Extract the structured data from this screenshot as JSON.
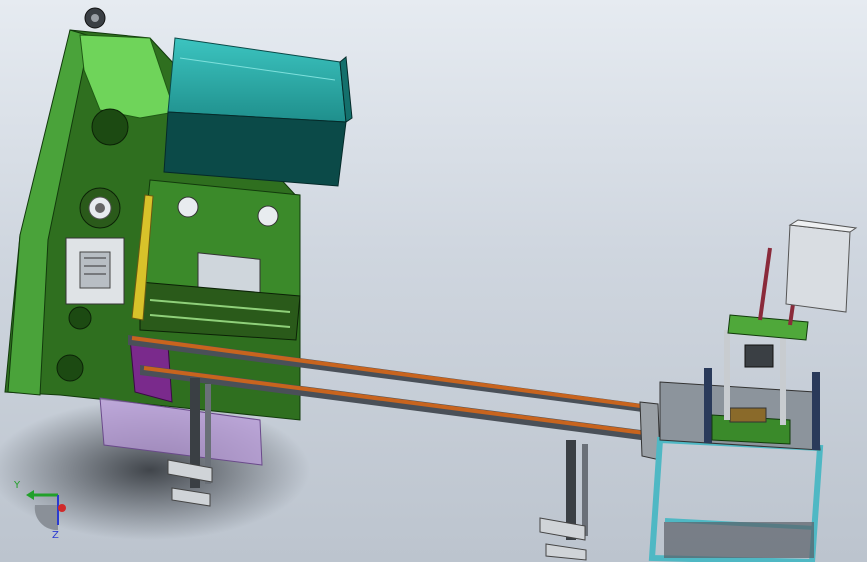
{
  "viewport": {
    "background_top": "#e6ebf1",
    "background_bottom": "#bcc4ce"
  },
  "colors": {
    "press_dark_green": "#2f6f1f",
    "press_light_green": "#5fc84c",
    "cover_teal": "#2aa3a0",
    "cover_dark_teal": "#0b4a48",
    "conveyor_orange": "#c8641e",
    "conveyor_rail": "#4a5058",
    "guard_violet": "#b89ad8",
    "chute_purple": "#7a2a8c",
    "guide_yellow": "#d8c22a",
    "frame_cyan": "#4fb8c4",
    "table_gray": "#8c949c",
    "cabinet_gray": "#d9dde2",
    "rod_maroon": "#8a2a3a"
  },
  "triad": {
    "icon": "coordinate-triad-icon",
    "y_label": "Y",
    "z_label": "Z",
    "y_color": "#22a02a",
    "z_color": "#2a3ad0",
    "x_color": "#d02a2a"
  }
}
